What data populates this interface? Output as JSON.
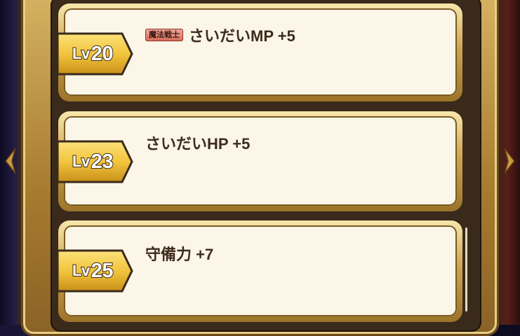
{
  "skills": [
    {
      "level_prefix": "Lv",
      "level_number": "20",
      "job_tag": "魔法戦士",
      "text": "さいだいMP +5"
    },
    {
      "level_prefix": "Lv",
      "level_number": "23",
      "job_tag": "",
      "text": "さいだいHP +5"
    },
    {
      "level_prefix": "Lv",
      "level_number": "25",
      "job_tag": "",
      "text": "守備力 +7"
    }
  ],
  "colors": {
    "card_fill": "#fbf6e8",
    "gold_border": "#cfa553",
    "ribbon_gold": "#f2c53d",
    "text_dark": "#3d2c1e",
    "job_tag_fill": "#d56d5c"
  },
  "icons": [
    "chevron-left-icon",
    "chevron-right-icon"
  ]
}
